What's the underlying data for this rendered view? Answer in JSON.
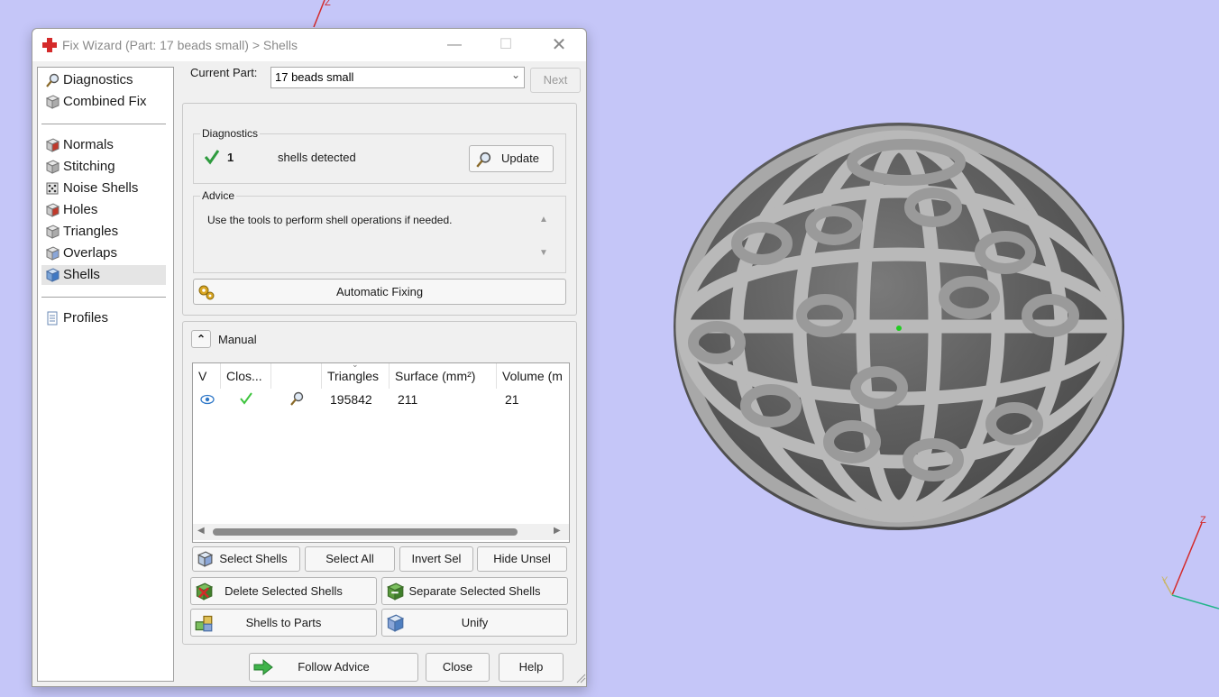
{
  "window": {
    "title": "Fix Wizard (Part: 17 beads small) > Shells"
  },
  "nav": {
    "items": [
      {
        "label": "Diagnostics",
        "icon": "magnifier-icon"
      },
      {
        "label": "Combined Fix",
        "icon": "cube-icon"
      },
      {
        "label": "Normals",
        "icon": "cube-red-icon"
      },
      {
        "label": "Stitching",
        "icon": "cube-icon"
      },
      {
        "label": "Noise Shells",
        "icon": "dice-icon"
      },
      {
        "label": "Holes",
        "icon": "cube-red-icon"
      },
      {
        "label": "Triangles",
        "icon": "cube-icon"
      },
      {
        "label": "Overlaps",
        "icon": "cube-icon"
      },
      {
        "label": "Shells",
        "icon": "cube-blue-icon"
      },
      {
        "label": "Profiles",
        "icon": "document-icon"
      }
    ],
    "active": "Shells"
  },
  "current_part": {
    "label": "Current Part:",
    "value": "17 beads small",
    "next_label": "Next"
  },
  "diagnostics": {
    "title": "Diagnostics",
    "count": "1",
    "text": "shells detected",
    "update_label": "Update"
  },
  "advice": {
    "title": "Advice",
    "text": "Use the tools to perform shell operations if needed."
  },
  "automatic_fixing_label": "Automatic Fixing",
  "manual": {
    "title": "Manual",
    "columns": [
      "V",
      "Clos...",
      "",
      "Triangles",
      "Surface (mm²)",
      "Volume (m"
    ],
    "rows": [
      {
        "triangles": "195842",
        "surface": "211",
        "volume": "21"
      }
    ]
  },
  "buttons": {
    "select_shells": "Select Shells",
    "select_all": "Select All",
    "invert_sel": "Invert Sel",
    "hide_unsel": "Hide Unsel",
    "delete_selected": "Delete Selected Shells",
    "separate_selected": "Separate Selected Shells",
    "shells_to_parts": "Shells to Parts",
    "unify": "Unify",
    "follow_advice": "Follow Advice",
    "close": "Close",
    "help": "Help"
  },
  "axes": {
    "top_label": "Z",
    "corner_z": "Z",
    "corner_y": "Y"
  },
  "colors": {
    "viewport": "#c5c6f8",
    "check": "#2e9b3e",
    "accent_red": "#d42a2a"
  }
}
